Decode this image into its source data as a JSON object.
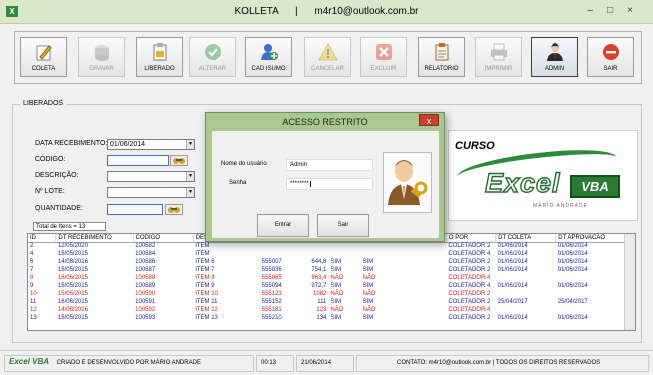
{
  "window": {
    "title": "KOLLETA",
    "separator": "|",
    "email": "m4r10@outlook.com.br"
  },
  "toolbar": [
    {
      "label": "COLETA",
      "icon": "pencil-icon",
      "state": "normal"
    },
    {
      "label": "GRAVAR",
      "icon": "save-icon",
      "state": "disabled"
    },
    {
      "label": "LIBERADO",
      "icon": "clipboard-icon",
      "state": "normal"
    },
    {
      "label": "ALTERAR",
      "icon": "check-icon",
      "state": "disabled"
    },
    {
      "label": "CAD ISUMO",
      "icon": "add-user-icon",
      "state": "normal"
    },
    {
      "label": "CANCELAR",
      "icon": "warning-icon",
      "state": "disabled"
    },
    {
      "label": "EXCLUIR",
      "icon": "delete-icon",
      "state": "disabled"
    },
    {
      "label": "RELATORIO",
      "icon": "report-icon",
      "state": "normal"
    },
    {
      "label": "IMPRIMIR",
      "icon": "printer-icon",
      "state": "disabled"
    },
    {
      "label": "ADMIN",
      "icon": "admin-user-icon",
      "state": "active"
    },
    {
      "label": "SAIR",
      "icon": "exit-icon",
      "state": "normal"
    }
  ],
  "form": {
    "group_label": "LIBERADOS",
    "data_recebimento_label": "DATA RECEBIMENTO:",
    "data_recebimento_value": "01/06/2014",
    "codigo_label": "CÓDIGO:",
    "descricao_label": "DESCRIÇÃO:",
    "lote_label": "Nº LOTE:",
    "quantidade_label": "QUANTIDADE:",
    "total": "Total de Itens =  13"
  },
  "logo": {
    "curso": "CURSO",
    "excel": "Excel",
    "vba": "VBA",
    "author": "MÁRIO ANDRADE"
  },
  "table": {
    "headers": [
      "ID",
      "DT RECEBIMENTO",
      "CODIGO",
      "DESC",
      "",
      "",
      "",
      "",
      "O POR",
      "DT COLETA",
      "DT APROVACAO"
    ],
    "rows": [
      {
        "color": "#1a1aa8",
        "cells": [
          "2",
          "12/05/2020",
          "100582",
          "ITEM",
          "",
          "",
          "",
          "",
          "COLETADOR 2",
          "01/06/2014",
          "01/06/2014"
        ]
      },
      {
        "color": "#1a1aa8",
        "cells": [
          "4",
          "15/05/2015",
          "100584",
          "ITEM",
          "",
          "",
          "",
          "",
          "COLETADOR 4",
          "01/06/2014",
          "01/06/2014"
        ]
      },
      {
        "color": "#1a1aa8",
        "cells": [
          "6",
          "14/08/2016",
          "100586",
          "ITEM 6",
          "555007",
          "644,8",
          "SIM",
          "SIM",
          "COLETADOR 2",
          "01/06/2014",
          "01/06/2014"
        ]
      },
      {
        "color": "#1a1aa8",
        "cells": [
          "7",
          "15/05/2015",
          "100587",
          "ITEM 7",
          "555036",
          "754,1",
          "SIM",
          "SIM",
          "COLETADOR 2",
          "01/06/2014",
          "01/06/2014"
        ]
      },
      {
        "color": "#d42020",
        "cells": [
          "8",
          "16/06/2015",
          "100588",
          "ITEM 8",
          "555065",
          "863,4",
          "NÃO",
          "NÃO",
          "COLETADOR 4",
          "",
          ""
        ]
      },
      {
        "color": "#1a1aa8",
        "cells": [
          "9",
          "15/05/2015",
          "100589",
          "ITEM 9",
          "555094",
          "972,7",
          "SIM",
          "SIM",
          "COLETADOR 4",
          "01/06/2014",
          "01/06/2014"
        ]
      },
      {
        "color": "#d42020",
        "cells": [
          "10",
          "15/05/2015",
          "100590",
          "ITEM 10",
          "555123",
          "1082",
          "NÃO",
          "NÃO",
          "COLETADOR 2",
          "",
          ""
        ]
      },
      {
        "color": "#1a1aa8",
        "cells": [
          "11",
          "16/06/2015",
          "100591",
          "ITEM 11",
          "555152",
          "111",
          "SIM",
          "SIM",
          "COLETADOR 2",
          "25/04/2017",
          "25/04/2017"
        ]
      },
      {
        "color": "#d42020",
        "cells": [
          "12",
          "14/08/2016",
          "100592",
          "ITEM 12",
          "555181",
          "123",
          "NÃO",
          "NÃO",
          "COLETADOR 4",
          "",
          ""
        ]
      },
      {
        "color": "#1a1aa8",
        "cells": [
          "13",
          "15/05/2015",
          "100593",
          "ITEM 13",
          "555210",
          "134",
          "SIM",
          "SIM",
          "COLETADOR 2",
          "01/06/2014",
          "01/06/2014"
        ]
      }
    ]
  },
  "modal": {
    "title": "ACESSO RESTRITO",
    "close": "x",
    "user_label": "Nome do usuário",
    "user_value": "Admin",
    "pass_label": "Senha",
    "pass_value": "********",
    "enter": "Entrar",
    "exit": "Sair"
  },
  "status": {
    "credits": "CRIADO E DESENVOLVIDO POR MÁRIO ANDRADE",
    "time": "00:13",
    "date": "21/06/2014",
    "contact": "CONTATO: m4r10@outlook.com.br | TODOS OS DIREITOS RESERVADOS"
  }
}
